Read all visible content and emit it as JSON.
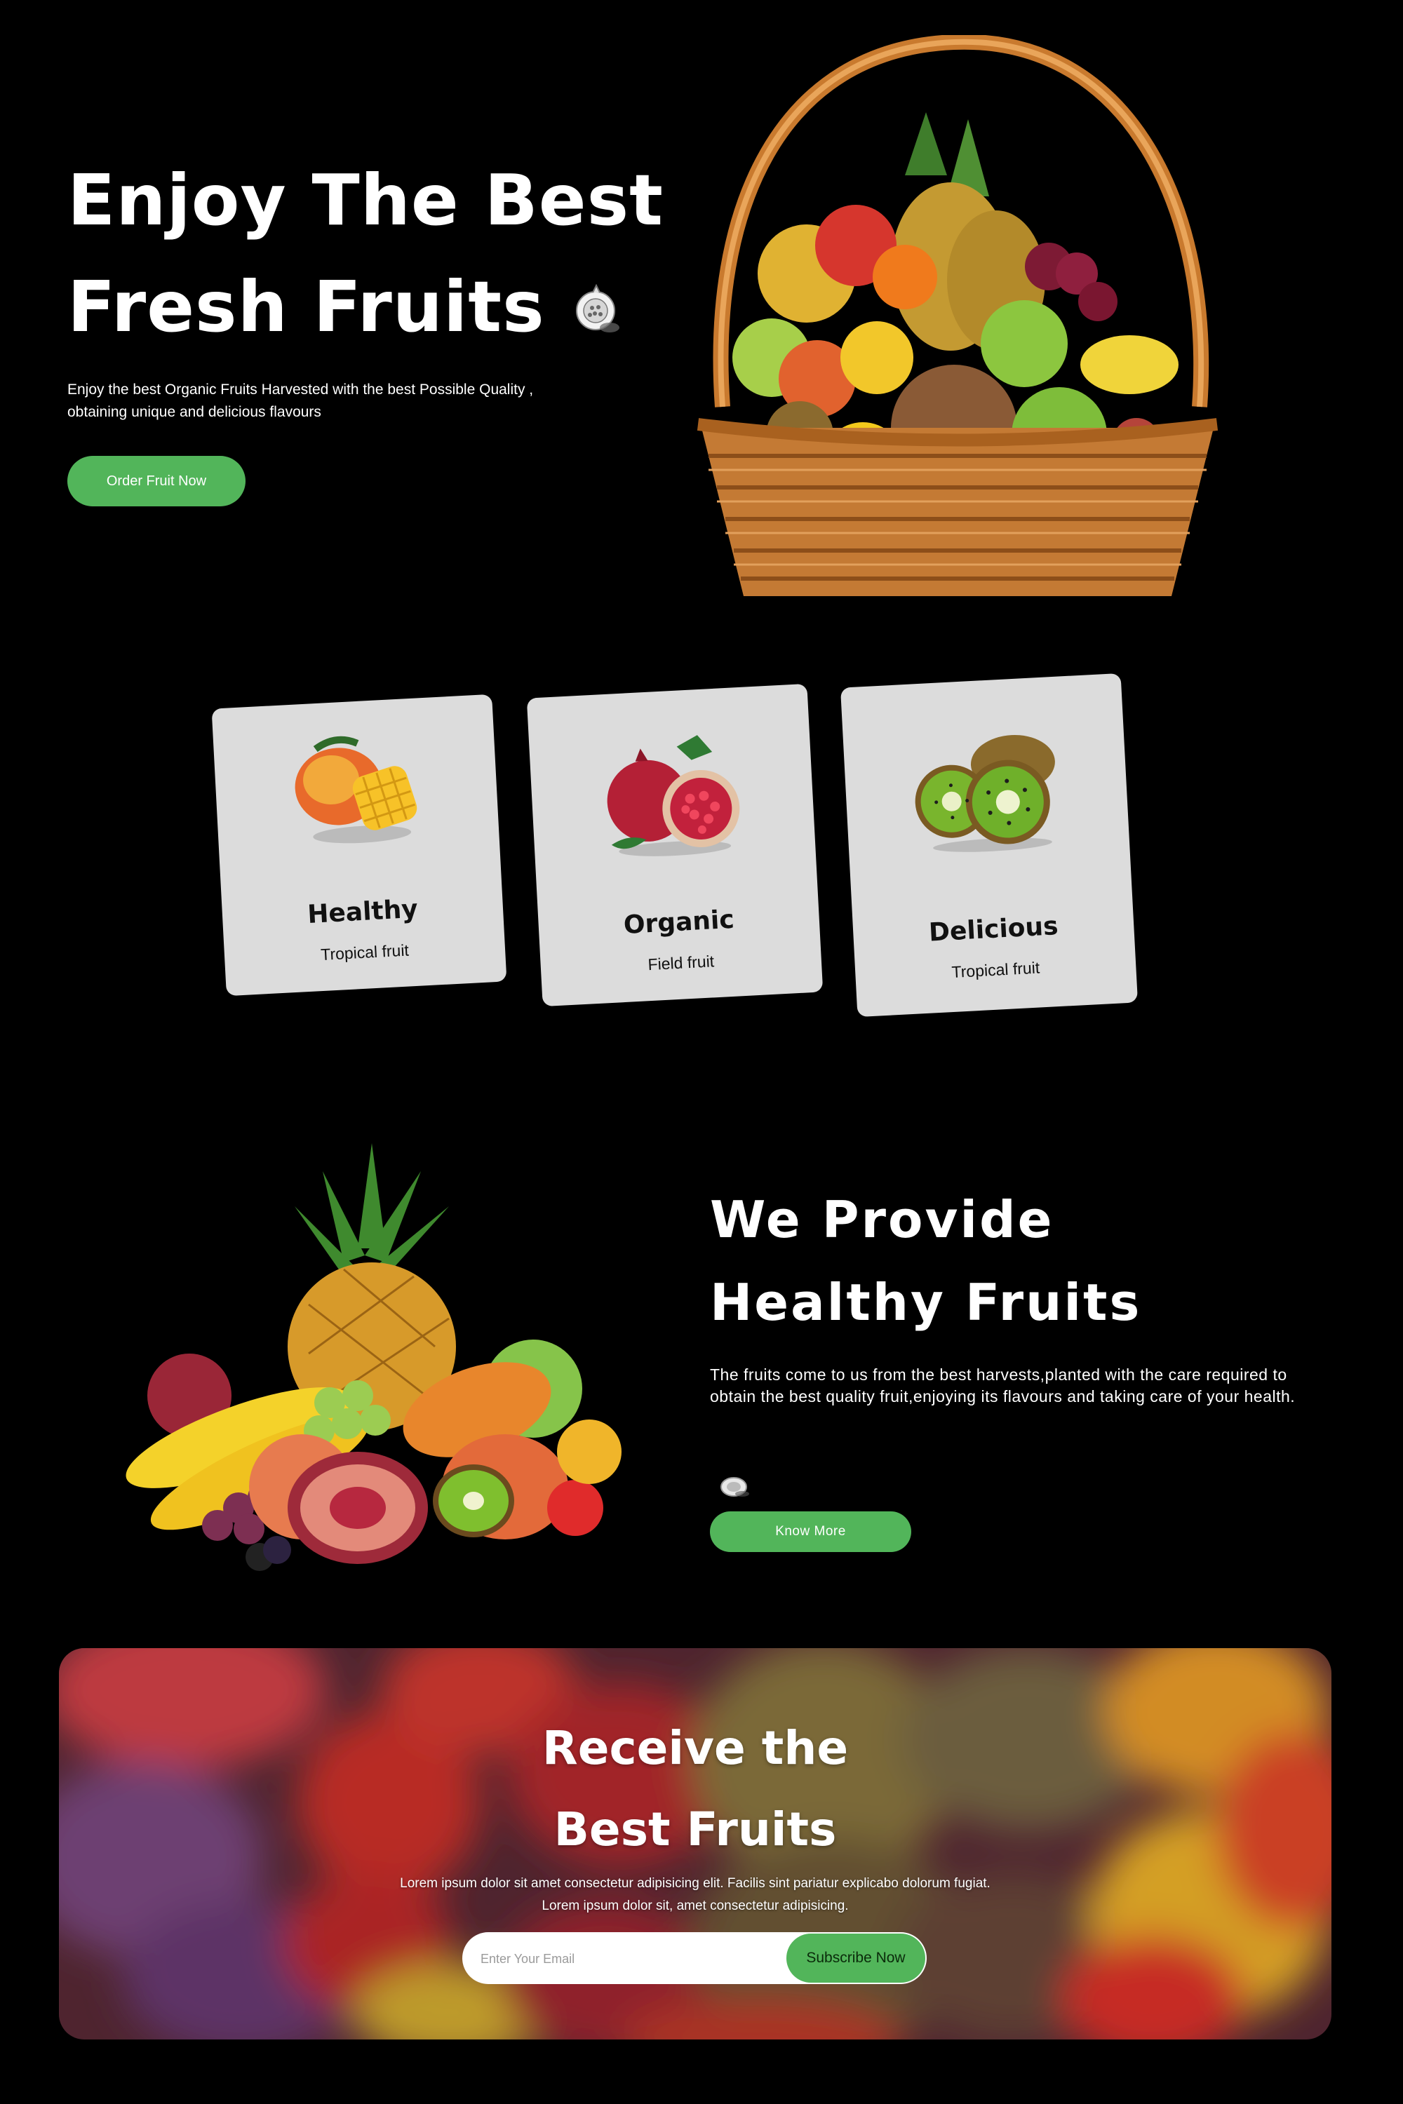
{
  "hero": {
    "title_line1": "Enjoy The Best",
    "title_line2": "Fresh Fruits",
    "subtitle_line1": "Enjoy the best Organic Fruits Harvested with the best Possible Quality ,",
    "subtitle_line2": "obtaining unique and delicious flavours",
    "button_label": "Order Fruit Now"
  },
  "cards": [
    {
      "title": "Healthy",
      "subtitle": "Tropical fruit",
      "fruit": "mango-icon"
    },
    {
      "title": "Organic",
      "subtitle": "Field fruit",
      "fruit": "pomegranate-icon"
    },
    {
      "title": "Delicious",
      "subtitle": "Tropical fruit",
      "fruit": "kiwi-icon"
    }
  ],
  "provide": {
    "title_line1": "We Provide",
    "title_line2": "Healthy Fruits",
    "text": "The fruits come to us from the best harvests,planted with the care required to obtain the best quality fruit,enjoying its flavours and taking care of your health.",
    "button_label": "Know More"
  },
  "subscribe": {
    "title_line1": "Receive the",
    "title_line2": "Best Fruits",
    "text_line1": "Lorem ipsum dolor sit amet consectetur adipisicing elit. Facilis sint pariatur explicabo dolorum fugiat.",
    "text_line2": "Lorem ipsum dolor sit, amet consectetur adipisicing.",
    "email_placeholder": "Enter Your Email",
    "button_label": "Subscribe Now"
  },
  "colors": {
    "background": "#000000",
    "accent_green": "#52b55a",
    "card_gray": "#dcdcdc"
  }
}
